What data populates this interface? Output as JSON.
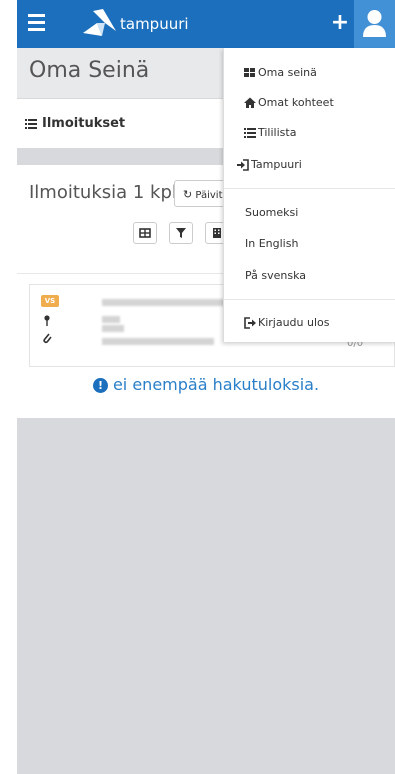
{
  "topbar": {
    "brand_name": "tampuuri",
    "plus_label": "+",
    "menu_icon": "hamburger-menu-icon",
    "user_icon": "user-icon",
    "colors": {
      "bar": "#1c6fbd",
      "user_button": "#4291d7"
    }
  },
  "page": {
    "title": "Oma Seinä",
    "section_label": "Ilmoitukset"
  },
  "listing": {
    "count_title": "Ilmoituksia 1 kpl",
    "refresh_label": "Päivitä",
    "tool_icons": [
      "grid-icon",
      "filter-icon",
      "building-icon"
    ],
    "card": {
      "badge": "VS",
      "count": "0/0"
    },
    "no_more_text": "ei enempää hakutuloksia."
  },
  "dropdown": {
    "items": [
      {
        "label": "Oma seinä",
        "icon": "th-large-icon"
      },
      {
        "label": "Omat kohteet",
        "icon": "home-icon"
      },
      {
        "label": "Tililista",
        "icon": "list-icon"
      },
      {
        "label": "Tampuuri",
        "icon": "sign-in-icon",
        "highlighted": true
      }
    ],
    "languages": [
      "Suomeksi",
      "In English",
      "På svenska"
    ],
    "logout_label": "Kirjaudu ulos",
    "highlight_color": "#ffff33"
  }
}
